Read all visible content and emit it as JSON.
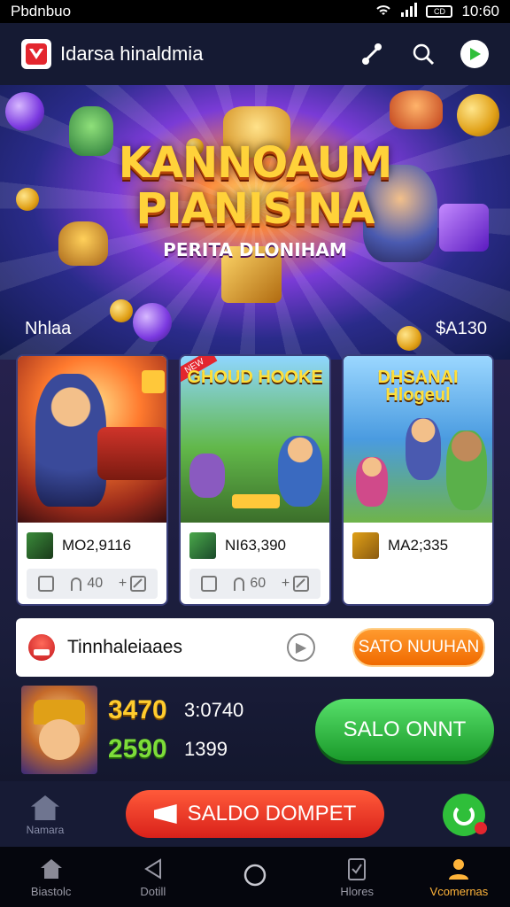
{
  "status_bar": {
    "left_text": "Pbdnbuo",
    "time": "10:60",
    "battery_text": "CD"
  },
  "app_bar": {
    "title": "Idarsa hinaldmia"
  },
  "banner": {
    "title_line1": "KANNOAUM",
    "title_line2": "PIANISINA",
    "subtitle": "PERITA DLONIHAM",
    "left_label": "Nhlaa",
    "right_label": "$A130"
  },
  "cards": [
    {
      "art_title": "",
      "ribbon": "",
      "value": "MO2,9116",
      "actions": [
        "40",
        "+"
      ]
    },
    {
      "art_title": "GHOUD HOOKE",
      "ribbon": "NEW",
      "value": "NI63,390",
      "actions": [
        "60",
        "+"
      ]
    },
    {
      "art_title": "DHSANAI Hlogeul",
      "ribbon": "",
      "value": "MA2;335",
      "actions": []
    }
  ],
  "notice": {
    "text": "Tinnhaleiaaes",
    "button_label": "SATO NUUHAN"
  },
  "balance": {
    "row1_main": "3470",
    "row1_sub": "3:0740",
    "row2_main": "2590",
    "row2_sub": "1399",
    "cta_label": "SALO ONNT"
  },
  "home_mini_label": "Namara",
  "wallet_button_label": "SALDO DOMPET",
  "bottom_nav": [
    {
      "label": "Biastolc",
      "icon": "home-icon"
    },
    {
      "label": "Dotill",
      "icon": "back-icon"
    },
    {
      "label": "",
      "icon": "circle-icon"
    },
    {
      "label": "Hlores",
      "icon": "clipboard-icon"
    },
    {
      "label": "Vcomernas",
      "icon": "user-icon"
    }
  ],
  "colors": {
    "accent_orange": "#f06a00",
    "accent_green": "#1a9a2a",
    "accent_red": "#d9211a",
    "nav_active": "#ffb43a"
  }
}
